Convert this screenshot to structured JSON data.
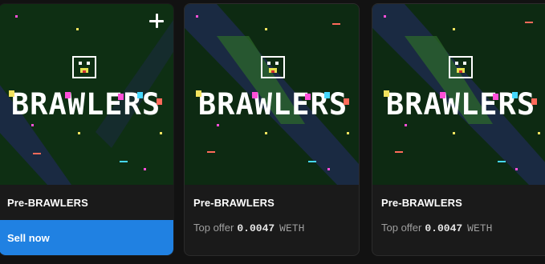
{
  "cards": [
    {
      "title": "Pre-BRAWLERS",
      "art_text": "BRAWLERS",
      "add_icon": "plus-icon",
      "action_label": "Sell now",
      "action_color": "#2081e2"
    },
    {
      "title": "Pre-BRAWLERS",
      "art_text": "BRAWLERS",
      "offer": {
        "label": "Top offer",
        "amount": "0.0047",
        "currency": "WETH"
      }
    },
    {
      "title": "Pre-BRAWLERS",
      "art_text": "BRAWLERS",
      "offer": {
        "label": "Top offer",
        "amount": "0.0047",
        "currency": "WETH"
      }
    }
  ],
  "colors": {
    "page_background": "#121212",
    "card_background": "#1a1a1a",
    "art_background": "#0d2a12",
    "letters": [
      "#f2e35e",
      "#ffffff",
      "#ff4fd8",
      "#ffffff",
      "#46d8ff",
      "#ff6a5a"
    ]
  }
}
